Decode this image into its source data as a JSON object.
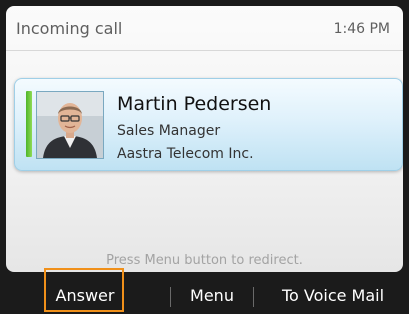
{
  "header": {
    "title": "Incoming call",
    "time": "1:46 PM"
  },
  "contact": {
    "name": "Martin Pedersen",
    "role": "Sales Manager",
    "company": "Aastra Telecom Inc.",
    "status_color": "#5cc42f",
    "avatar_icon": "contact-photo"
  },
  "hint": "Press Menu button to redirect.",
  "softkeys": {
    "answer": "Answer",
    "menu": "Menu",
    "voicemail": "To Voice Mail"
  },
  "colors": {
    "highlight": "#f0901a",
    "card_accent": "#9fcfe7"
  }
}
